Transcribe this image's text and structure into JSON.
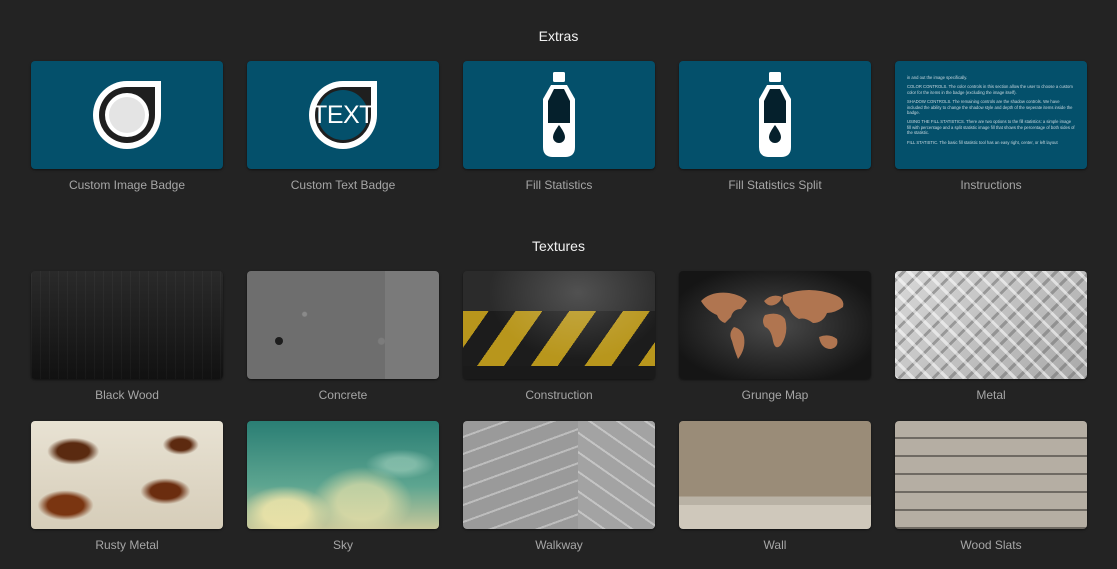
{
  "sections": {
    "extras": {
      "title": "Extras",
      "items": [
        {
          "label": "Custom Image Badge"
        },
        {
          "label": "Custom Text Badge",
          "badge_text": "TEXT"
        },
        {
          "label": "Fill Statistics"
        },
        {
          "label": "Fill Statistics Split"
        },
        {
          "label": "Instructions",
          "preview_lines": [
            "in and out the image specifically.",
            "COLOR CONTROLS. The color controls in this section allow the user to choose a custom color for the items in the badge (excluding the image itself).",
            "SHADOW CONTROLS. The remaining controls are the shadow controls. We have included the ability to change the shadow style and depth of the seperate items inside the badge.",
            "USING THE FILL STATISTICS. There are two options to the fill statistics: a simple image fill with percentage and a split statistic image fill that shows the percentage of both sides of the statistic.",
            "FILL STATISTIC. The basic fill statistic tool has an easy right, center, or left layout"
          ]
        }
      ]
    },
    "textures": {
      "title": "Textures",
      "items": [
        {
          "label": "Black Wood"
        },
        {
          "label": "Concrete"
        },
        {
          "label": "Construction"
        },
        {
          "label": "Grunge Map"
        },
        {
          "label": "Metal"
        },
        {
          "label": "Rusty Metal"
        },
        {
          "label": "Sky"
        },
        {
          "label": "Walkway"
        },
        {
          "label": "Wall"
        },
        {
          "label": "Wood Slats"
        }
      ]
    }
  },
  "colors": {
    "background": "#232323",
    "tile_teal": "#04506b"
  }
}
